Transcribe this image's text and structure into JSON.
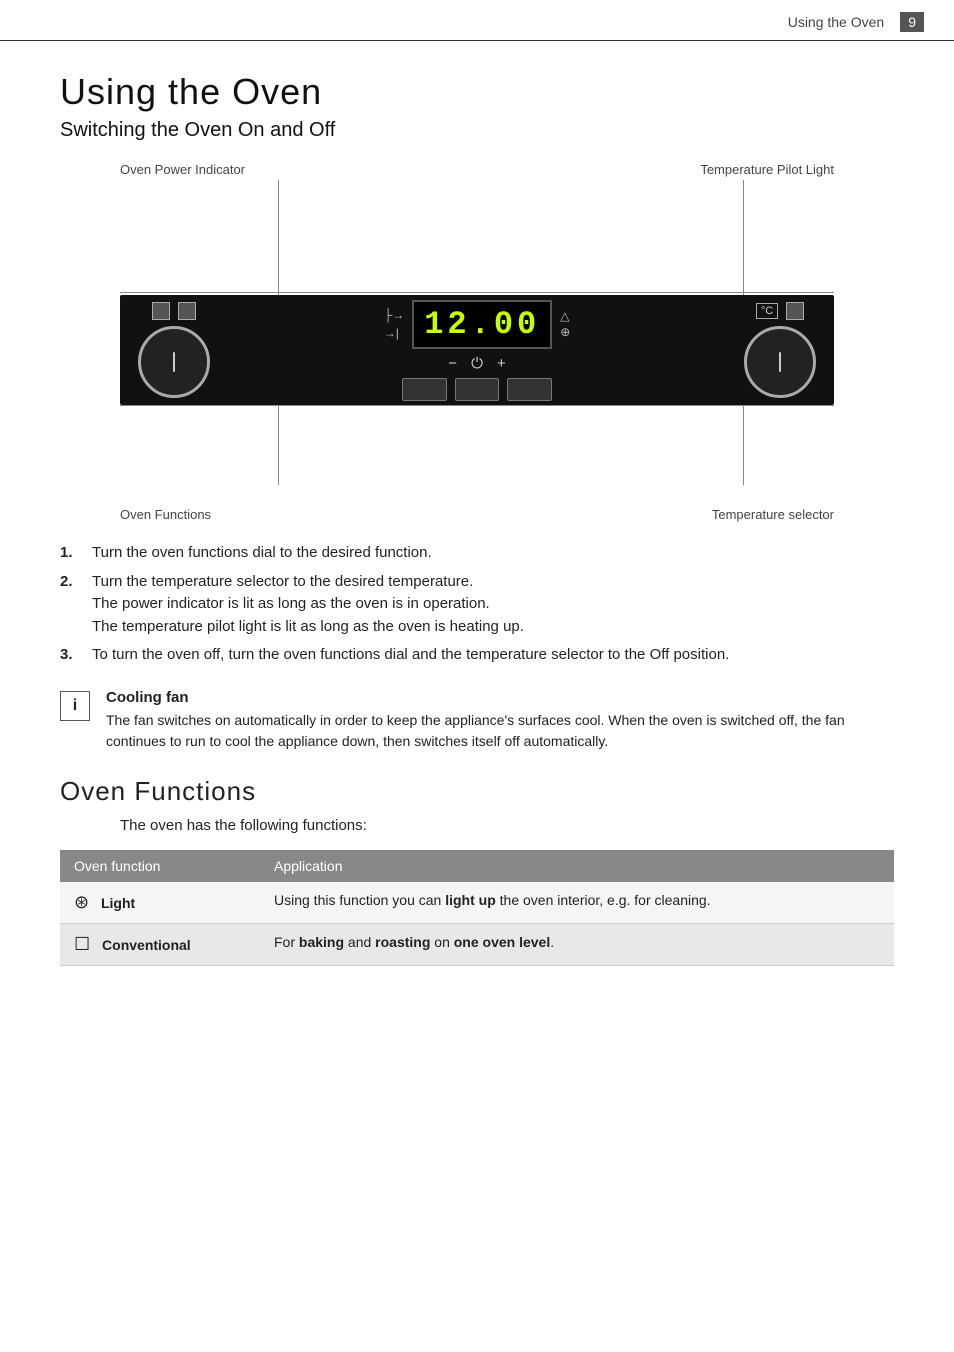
{
  "header": {
    "title": "Using the Oven",
    "page_number": "9"
  },
  "page_title": "Using the Oven",
  "section1": {
    "heading": "Switching the Oven On and Off",
    "label_top_left": "Oven Power Indicator",
    "label_top_right": "Temperature Pilot Light",
    "label_bottom_left": "Oven Functions",
    "label_bottom_right": "Temperature selector",
    "display_time": "12.00"
  },
  "instructions": [
    {
      "number": "1.",
      "text": "Turn the oven functions dial to the desired function."
    },
    {
      "number": "2.",
      "text": "Turn the temperature selector to the desired temperature.\nThe power indicator is lit as long as the oven is in operation.\nThe temperature pilot light is lit as long as the oven is heating up."
    },
    {
      "number": "3.",
      "text": "To turn the oven off, turn the oven functions dial and the temperature selector to the Off position."
    }
  ],
  "info_box": {
    "icon": "i",
    "title": "Cooling fan",
    "text": "The fan switches on automatically in order to keep the appliance's surfaces cool. When the oven is switched off, the fan continues to run to cool the appliance down, then switches itself off automatically."
  },
  "section2": {
    "title": "Oven Functions",
    "intro": "The oven has the following functions:",
    "table_headers": [
      "Oven function",
      "Application"
    ],
    "rows": [
      {
        "icon": "⊛",
        "function_name": "Light",
        "application": "Using this function you can light up the oven interior, e.g. for cleaning.",
        "bold_parts": [
          "light up"
        ]
      },
      {
        "icon": "☐",
        "function_name": "Conventional",
        "application": "For baking and roasting on one oven level.",
        "bold_parts": [
          "baking",
          "roasting",
          "one oven level"
        ]
      }
    ]
  }
}
